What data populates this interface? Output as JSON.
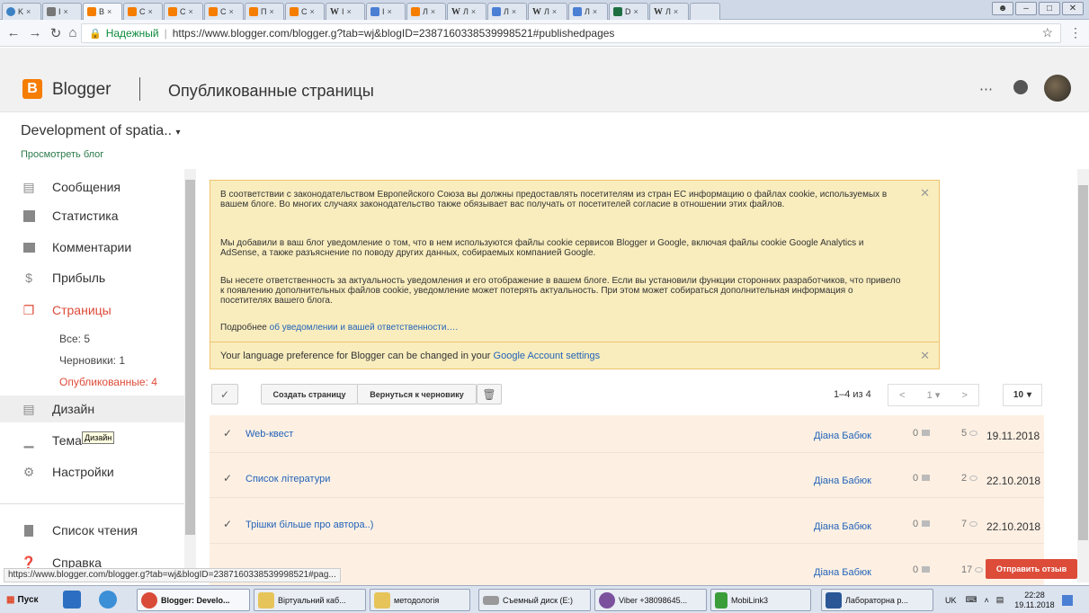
{
  "browser": {
    "tabs": [
      {
        "label": "K",
        "icon": "chrome-icon"
      },
      {
        "label": "I",
        "icon": "page-icon"
      },
      {
        "label": "B",
        "icon": "blogger-icon",
        "active": true
      },
      {
        "label": "C",
        "icon": "blogger-icon"
      },
      {
        "label": "C",
        "icon": "blogger-icon"
      },
      {
        "label": "C",
        "icon": "blogger-icon"
      },
      {
        "label": "П",
        "icon": "blogger-icon"
      },
      {
        "label": "C",
        "icon": "blogger-icon"
      },
      {
        "label": "I",
        "icon": "wikipedia-icon"
      },
      {
        "label": "I",
        "icon": "docs-icon"
      },
      {
        "label": "Л",
        "icon": "blogger-icon"
      },
      {
        "label": "Л",
        "icon": "wikipedia-icon"
      },
      {
        "label": "Л",
        "icon": "docs-icon"
      },
      {
        "label": "Л",
        "icon": "wikipedia-icon"
      },
      {
        "label": "Л",
        "icon": "docs-icon"
      },
      {
        "label": "D",
        "icon": "excel-icon"
      },
      {
        "label": "Л",
        "icon": "wikipedia-icon"
      }
    ],
    "secure_label": "Надежный",
    "url": "https://www.blogger.com/blogger.g?tab=wj&blogID=2387160338539998521#publishedpages"
  },
  "header": {
    "brand": "Blogger",
    "page_title": "Опубликованные страницы"
  },
  "blog": {
    "name": "Development of spatia..",
    "view_link": "Просмотреть блог"
  },
  "sidebar": {
    "items": [
      {
        "label": "Сообщения",
        "icon": "posts-icon"
      },
      {
        "label": "Статистика",
        "icon": "stats-icon"
      },
      {
        "label": "Комментарии",
        "icon": "comments-icon"
      },
      {
        "label": "Прибыль",
        "icon": "dollar-icon"
      },
      {
        "label": "Страницы",
        "icon": "pages-icon",
        "active": true
      },
      {
        "label": "Дизайн",
        "icon": "layout-icon"
      },
      {
        "label": "Тема",
        "icon": "theme-icon"
      },
      {
        "label": "Настройки",
        "icon": "gear-icon"
      },
      {
        "label": "Список чтения",
        "icon": "bookmark-icon"
      },
      {
        "label": "Справка",
        "icon": "help-icon"
      }
    ],
    "subitems": [
      "Все: 5",
      "Черновики: 1",
      "Опубликованные: 4"
    ],
    "tooltip": "Дизайн"
  },
  "notice": {
    "p1": "В соответствии с законодательством Европейского Союза вы должны предоставлять посетителям из стран ЕС информацию о файлах cookie, используемых в вашем блоге. Во многих случаях законодательство также обязывает вас получать от посетителей согласие в отношении этих файлов.",
    "p2": "Мы добавили в ваш блог уведомление о том, что в нем используются файлы cookie сервисов Blogger и Google, включая файлы cookie Google Analytics и AdSense, а также разъяснение по поводу других данных, собираемых компанией Google.",
    "p3": "Вы несете ответственность за актуальность уведомления и его отображение в вашем блоге. Если вы установили функции сторонних разработчиков, что привело к появлению дополнительных файлов cookie, уведомление может потерять актуальность. При этом может собираться дополнительная информация о посетителях вашего блога.",
    "p4_prefix": "Подробнее ",
    "p4_link": "об уведомлении и вашей ответственности….",
    "lang_text": "Your language preference for Blogger can be changed in your ",
    "lang_link": "Google Account settings"
  },
  "toolbar": {
    "create_label": "Создать страницу",
    "revert_label": "Вернуться к черновику",
    "count": "1–4 из 4",
    "page": "1",
    "per_page": "10"
  },
  "pages": [
    {
      "title": "Web-квест",
      "author": "Діана Бабюк",
      "comments": "0",
      "views": "5",
      "date": "19.11.2018"
    },
    {
      "title": "Список літератури",
      "author": "Діана Бабюк",
      "comments": "0",
      "views": "2",
      "date": "22.10.2018"
    },
    {
      "title": "Трішки більше про автора..)",
      "author": "Діана Бабюк",
      "comments": "0",
      "views": "7",
      "date": "22.10.2018"
    },
    {
      "title": "",
      "author": "Діана Бабюк",
      "comments": "0",
      "views": "17",
      "date": ""
    }
  ],
  "feedback_label": "Отправить отзыв",
  "status_url": "https://www.blogger.com/blogger.g?tab=wj&blogID=2387160338539998521#pag...",
  "taskbar": {
    "start": "Пуск",
    "tasks": [
      {
        "label": "Blogger: Develo...",
        "icon": "chrome-icon",
        "active": true
      },
      {
        "label": "Віртуальний каб...",
        "icon": "folder-icon"
      },
      {
        "label": "методологія",
        "icon": "folder-icon"
      },
      {
        "label": "Съемный диск (E:)",
        "icon": "drive-icon"
      },
      {
        "label": "Viber +38098645...",
        "icon": "viber-icon"
      },
      {
        "label": "MobiLink3",
        "icon": "wifi-icon"
      },
      {
        "label": "Лабораторна р...",
        "icon": "word-icon"
      }
    ],
    "lang": "UK",
    "time": "22:28",
    "date": "19.11.2018"
  },
  "colors": {
    "accent": "#dd4b39",
    "blogger_orange": "#f57d00",
    "notice_bg": "#f9edbe",
    "row_bg": "#fdf0e3",
    "link": "#2263b8"
  }
}
